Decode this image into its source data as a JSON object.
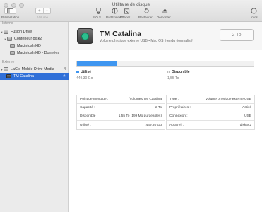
{
  "window": {
    "title": "Utilitaire de disque"
  },
  "toolbar": {
    "presentation_label": "Présentation",
    "volume_label": "Volume",
    "buttons": [
      {
        "label": "S.O.S.",
        "icon": "stethoscope-icon"
      },
      {
        "label": "Partitionner",
        "icon": "partition-icon"
      },
      {
        "label": "Effacer",
        "icon": "erase-icon"
      },
      {
        "label": "Restaurer",
        "icon": "restore-icon"
      },
      {
        "label": "Démonter",
        "icon": "eject-icon"
      }
    ],
    "info_label": "Infos"
  },
  "sidebar": {
    "internal_header": "Interne",
    "internal": [
      {
        "label": "Fusion Drive"
      },
      {
        "label": "Conteneur disk2"
      },
      {
        "label": "Macintosh HD"
      },
      {
        "label": "Macintosh HD - Données"
      }
    ],
    "external_header": "Externe",
    "external": [
      {
        "label": "LaCie Mobile Drive Media",
        "count": "4"
      },
      {
        "label": "TM Catalina",
        "count": "≙"
      }
    ]
  },
  "volume": {
    "name": "TM Catalina",
    "subtitle": "Volume physique externe USB • Mac OS étendu (journalisé)",
    "size_button": "2 To",
    "usage_fraction": 0.225,
    "used_label": "Utilisé",
    "used_value": "449,30 Go",
    "free_label": "Disponible",
    "free_value": "1,55 To",
    "used_color": "#3f96f0",
    "free_color": "#f1f1f1"
  },
  "info_left": [
    {
      "key": "Point de montage :",
      "value": "/Volumes/TM Catalina"
    },
    {
      "key": "Capacité :",
      "value": "2 To"
    },
    {
      "key": "Disponible :",
      "value": "1,55 To (199 Mo purgeables)"
    },
    {
      "key": "Utilisé :",
      "value": "449,30 Go"
    }
  ],
  "info_right": [
    {
      "key": "Type :",
      "value": "Volume physique externe USB"
    },
    {
      "key": "Propriétaires :",
      "value": "Activé"
    },
    {
      "key": "Connexion :",
      "value": "USB"
    },
    {
      "key": "Appareil :",
      "value": "disk3s2"
    }
  ]
}
